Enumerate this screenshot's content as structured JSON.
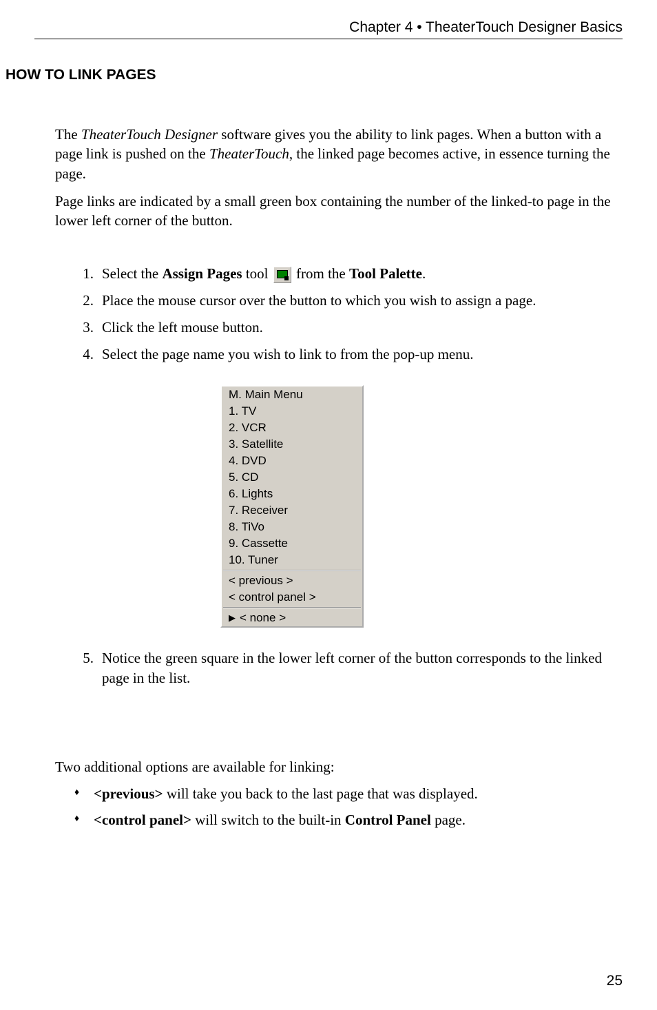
{
  "header": "Chapter 4 • TheaterTouch Designer Basics",
  "title": "HOW TO LINK PAGES",
  "intro": {
    "p1_pre": "The ",
    "p1_i1": "TheaterTouch Designer",
    "p1_mid": " software gives you the ability to link pages. When a button with a page link is pushed on the ",
    "p1_i2": "TheaterTouch",
    "p1_post": ", the linked page becomes active, in essence turning the page.",
    "p2": "Page links are indicated by a small green box containing the number of the linked-to page in the lower left corner of the button."
  },
  "steps": {
    "s1_pre": "Select the ",
    "s1_b1": "Assign Pages",
    "s1_mid": " tool ",
    "s1_mid2": " from the ",
    "s1_b2": "Tool Palette",
    "s1_post": ".",
    "s2": "Place the mouse cursor over the button to which you wish to assign a page.",
    "s3": "Click the left mouse button.",
    "s4": "Select the page name you wish to link to from the pop-up menu.",
    "s5": "Notice the green square in the lower left corner of the button corresponds to the linked page in the list."
  },
  "menu": [
    "M. Main Menu",
    "1. TV",
    "2. VCR",
    "3. Satellite",
    "4. DVD",
    "5. CD",
    "6. Lights",
    "7. Receiver",
    "8. TiVo",
    "9. Cassette",
    "10. Tuner"
  ],
  "menu2": [
    "< previous >",
    "< control panel >"
  ],
  "menu3": "< none >",
  "after_intro": "Two additional options are available for linking:",
  "bullets": {
    "b1_b": "<previous>",
    "b1_t": " will take you back to the last page that was displayed.",
    "b2_b": "<control panel>",
    "b2_t1": " will switch to the built-in ",
    "b2_bb": "Control Panel",
    "b2_t2": " page."
  },
  "page_num": "25",
  "nums": [
    "1.",
    "2.",
    "3.",
    "4.",
    "5."
  ]
}
